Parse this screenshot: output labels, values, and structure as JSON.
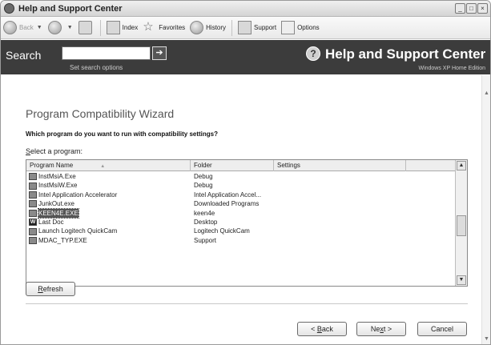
{
  "window": {
    "title": "Help and Support Center"
  },
  "toolbar": {
    "back_label": "Back",
    "index_label": "Index",
    "favorites_label": "Favorites",
    "history_label": "History",
    "support_label": "Support",
    "options_label": "Options"
  },
  "header": {
    "search_label": "Search",
    "search_value": "",
    "set_search_options": "Set search options",
    "title": "Help and Support Center",
    "subtitle": "Windows XP Home Edition"
  },
  "wizard": {
    "title": "Program Compatibility Wizard",
    "question": "Which program do you want to run with compatibility settings?",
    "select_label_prefix": "S",
    "select_label_rest": "elect a program:",
    "columns": {
      "name": "Program Name",
      "folder": "Folder",
      "settings": "Settings"
    },
    "rows": [
      {
        "name": "InstMsiA.Exe",
        "folder": "Debug",
        "icon": "installer-icon"
      },
      {
        "name": "InstMsiW.Exe",
        "folder": "Debug",
        "icon": "installer-icon"
      },
      {
        "name": "Intel Application Accelerator",
        "folder": "Intel Application Accel...",
        "icon": "chip-icon"
      },
      {
        "name": "JunkOut.exe",
        "folder": "Downloaded Programs",
        "icon": "program-icon"
      },
      {
        "name": "KEEN4E.EXE",
        "folder": "keen4e",
        "icon": "dos-icon",
        "selected": true
      },
      {
        "name": "Last Doc",
        "folder": "Desktop",
        "icon": "word-icon"
      },
      {
        "name": "Launch Logitech QuickCam",
        "folder": "Logitech QuickCam",
        "icon": "camera-icon"
      },
      {
        "name": "MDAC_TYP.EXE",
        "folder": "Support",
        "icon": "installer-icon"
      }
    ],
    "refresh_prefix": "R",
    "refresh_rest": "efresh",
    "back_prefix": "< ",
    "back_u": "B",
    "back_rest": "ack",
    "next_prefix": "Ne",
    "next_u": "x",
    "next_rest": "t >",
    "cancel_label": "Cancel"
  },
  "colors": {
    "header_bg": "#3c3c3c",
    "selected_row_bg": "#555555"
  }
}
